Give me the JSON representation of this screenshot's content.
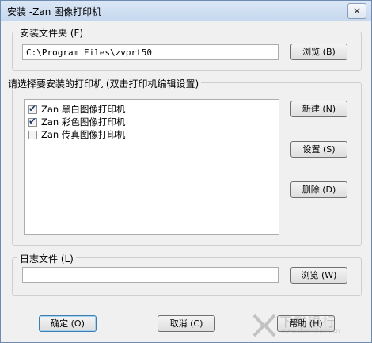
{
  "window": {
    "title": "安装 -Zan 图像打印机",
    "close_label": "✕"
  },
  "install_folder": {
    "label": "安装文件夹 (F)",
    "path": "C:\\Program Files\\zvprt50",
    "browse_label": "浏览 (B)"
  },
  "printers": {
    "label": "请选择要安装的打印机 (双击打印机编辑设置)",
    "items": [
      {
        "label": "Zan 黑白图像打印机",
        "checked": true
      },
      {
        "label": "Zan 彩色图像打印机",
        "checked": true
      },
      {
        "label": "Zan 传真图像打印机",
        "checked": false
      }
    ],
    "new_label": "新建 (N)",
    "settings_label": "设置 (S)",
    "delete_label": "删除 (D)"
  },
  "log_file": {
    "label": "日志文件 (L)",
    "path": "",
    "browse_label": "浏览 (W)"
  },
  "footer": {
    "ok_label": "确定 (O)",
    "cancel_label": "取消 (C)",
    "help_label": "帮助 (H)"
  },
  "watermark": {
    "text": "下载银行",
    "url": "www.downbank.cn"
  },
  "colors": {
    "accent": "#3c7fb1",
    "titlebar": "#c5d8ee"
  }
}
